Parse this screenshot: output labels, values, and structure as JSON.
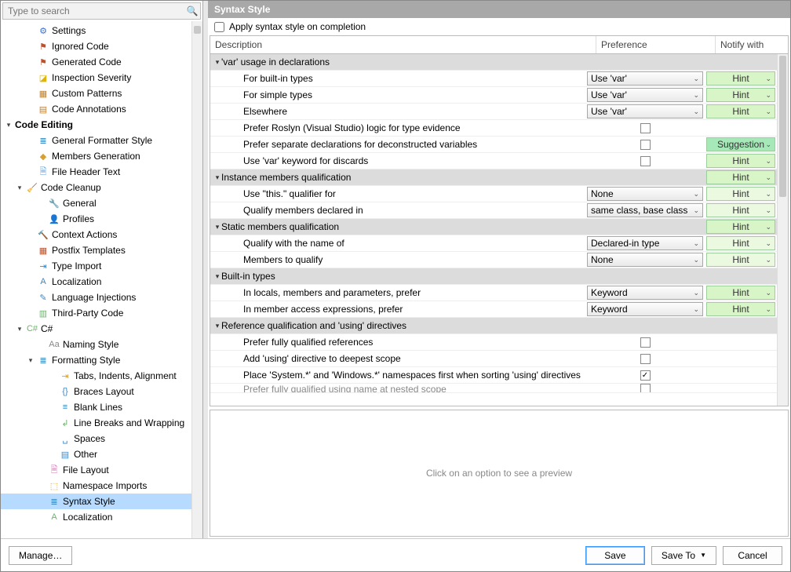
{
  "search": {
    "placeholder": "Type to search"
  },
  "sidebar": {
    "items": [
      {
        "indent": 2,
        "toggle": "",
        "icon": "⚙",
        "iconColor": "#3a6fd8",
        "label": "Settings"
      },
      {
        "indent": 2,
        "toggle": "",
        "icon": "⚑",
        "iconColor": "#c05028",
        "label": "Ignored Code"
      },
      {
        "indent": 2,
        "toggle": "",
        "icon": "⚑",
        "iconColor": "#c05028",
        "label": "Generated Code"
      },
      {
        "indent": 2,
        "toggle": "",
        "icon": "◪",
        "iconColor": "#e0b400",
        "label": "Inspection Severity"
      },
      {
        "indent": 2,
        "toggle": "",
        "icon": "▦",
        "iconColor": "#c08028",
        "label": "Custom Patterns"
      },
      {
        "indent": 2,
        "toggle": "",
        "icon": "▤",
        "iconColor": "#c08028",
        "label": "Code Annotations"
      },
      {
        "indent": 0,
        "toggle": "▾",
        "icon": "",
        "iconColor": "",
        "label": "Code Editing",
        "bold": true
      },
      {
        "indent": 2,
        "toggle": "",
        "icon": "≣",
        "iconColor": "#3a88c8",
        "label": "General Formatter Style"
      },
      {
        "indent": 2,
        "toggle": "",
        "icon": "◆",
        "iconColor": "#d8a030",
        "label": "Members Generation"
      },
      {
        "indent": 2,
        "toggle": "",
        "icon": "🗎",
        "iconColor": "#5899d4",
        "label": "File Header Text"
      },
      {
        "indent": 1,
        "toggle": "▾",
        "icon": "🧹",
        "iconColor": "#6bb46b",
        "label": "Code Cleanup"
      },
      {
        "indent": 3,
        "toggle": "",
        "icon": "🔧",
        "iconColor": "#6bb46b",
        "label": "General"
      },
      {
        "indent": 3,
        "toggle": "",
        "icon": "👤",
        "iconColor": "#d89048",
        "label": "Profiles"
      },
      {
        "indent": 2,
        "toggle": "",
        "icon": "🔨",
        "iconColor": "#9a7040",
        "label": "Context Actions"
      },
      {
        "indent": 2,
        "toggle": "",
        "icon": "▦",
        "iconColor": "#c05028",
        "label": "Postfix Templates"
      },
      {
        "indent": 2,
        "toggle": "",
        "icon": "⇥",
        "iconColor": "#3a88c8",
        "label": "Type Import"
      },
      {
        "indent": 2,
        "toggle": "",
        "icon": "A",
        "iconColor": "#3a88c8",
        "label": "Localization"
      },
      {
        "indent": 2,
        "toggle": "",
        "icon": "✎",
        "iconColor": "#3a88c8",
        "label": "Language Injections"
      },
      {
        "indent": 2,
        "toggle": "",
        "icon": "▥",
        "iconColor": "#6bb46b",
        "label": "Third-Party Code"
      },
      {
        "indent": 1,
        "toggle": "▾",
        "icon": "C#",
        "iconColor": "#6bb46b",
        "label": "C#"
      },
      {
        "indent": 3,
        "toggle": "",
        "icon": "Aa",
        "iconColor": "#888",
        "label": "Naming Style"
      },
      {
        "indent": 2,
        "toggle": "▾",
        "icon": "≣",
        "iconColor": "#3a88c8",
        "label": "Formatting Style"
      },
      {
        "indent": 4,
        "toggle": "",
        "icon": "⇥",
        "iconColor": "#d8a030",
        "label": "Tabs, Indents, Alignment"
      },
      {
        "indent": 4,
        "toggle": "",
        "icon": "{}",
        "iconColor": "#3a88c8",
        "label": "Braces Layout"
      },
      {
        "indent": 4,
        "toggle": "",
        "icon": "≡",
        "iconColor": "#3a88c8",
        "label": "Blank Lines"
      },
      {
        "indent": 4,
        "toggle": "",
        "icon": "↲",
        "iconColor": "#6bb46b",
        "label": "Line Breaks and Wrapping"
      },
      {
        "indent": 4,
        "toggle": "",
        "icon": "␣",
        "iconColor": "#3a88c8",
        "label": "Spaces"
      },
      {
        "indent": 4,
        "toggle": "",
        "icon": "▤",
        "iconColor": "#3a88c8",
        "label": "Other"
      },
      {
        "indent": 3,
        "toggle": "",
        "icon": "🗎",
        "iconColor": "#d070b0",
        "label": "File Layout"
      },
      {
        "indent": 3,
        "toggle": "",
        "icon": "⬚",
        "iconColor": "#d8a030",
        "label": "Namespace Imports"
      },
      {
        "indent": 3,
        "toggle": "",
        "icon": "≣",
        "iconColor": "#3a88c8",
        "label": "Syntax Style",
        "selected": true
      },
      {
        "indent": 3,
        "toggle": "",
        "icon": "A",
        "iconColor": "#6bb46b",
        "label": "Localization"
      }
    ]
  },
  "content": {
    "title": "Syntax Style",
    "apply_label": "Apply syntax style on completion",
    "apply_checked": false,
    "columns": {
      "description": "Description",
      "preference": "Preference",
      "notify": "Notify with"
    },
    "rows": [
      {
        "type": "group",
        "label": "'var' usage in declarations"
      },
      {
        "type": "combo",
        "indent": 2,
        "label": "For built-in types",
        "pref": "Use 'var'",
        "notify": "Hint"
      },
      {
        "type": "combo",
        "indent": 2,
        "label": "For simple types",
        "pref": "Use 'var'",
        "notify": "Hint"
      },
      {
        "type": "combo",
        "indent": 2,
        "label": "Elsewhere",
        "pref": "Use 'var'",
        "notify": "Hint"
      },
      {
        "type": "check",
        "indent": 2,
        "label": "Prefer Roslyn (Visual Studio) logic for type evidence",
        "checked": false
      },
      {
        "type": "check",
        "indent": 2,
        "label": "Prefer separate declarations for deconstructed variables",
        "checked": false,
        "notify": "Suggestion",
        "notifyStyle": "sugg"
      },
      {
        "type": "check",
        "indent": 2,
        "label": "Use 'var' keyword for discards",
        "checked": false,
        "notify": "Hint"
      },
      {
        "type": "group",
        "label": "Instance members qualification",
        "notify": "Hint"
      },
      {
        "type": "combo",
        "indent": 2,
        "label": "Use \"this.\" qualifier for",
        "pref": "None",
        "notify": "Hint",
        "notifyStyle": "dim"
      },
      {
        "type": "combo",
        "indent": 2,
        "label": "Qualify members declared in",
        "pref": "same class, base class",
        "notify": "Hint",
        "notifyStyle": "dim"
      },
      {
        "type": "group",
        "label": "Static members qualification",
        "notify": "Hint"
      },
      {
        "type": "combo",
        "indent": 2,
        "label": "Qualify with the name of",
        "pref": "Declared-in type",
        "notify": "Hint",
        "notifyStyle": "dim"
      },
      {
        "type": "combo",
        "indent": 2,
        "label": "Members to qualify",
        "pref": "None",
        "notify": "Hint",
        "notifyStyle": "dim"
      },
      {
        "type": "group",
        "label": "Built-in types"
      },
      {
        "type": "combo",
        "indent": 2,
        "label": "In locals, members and parameters, prefer",
        "pref": "Keyword",
        "notify": "Hint"
      },
      {
        "type": "combo",
        "indent": 2,
        "label": "In member access expressions, prefer",
        "pref": "Keyword",
        "notify": "Hint"
      },
      {
        "type": "group",
        "label": "Reference qualification and 'using' directives"
      },
      {
        "type": "check",
        "indent": 2,
        "label": "Prefer fully qualified references",
        "checked": false
      },
      {
        "type": "check",
        "indent": 2,
        "label": "Add 'using' directive to deepest scope",
        "checked": false
      },
      {
        "type": "check",
        "indent": 2,
        "label": "Place 'System.*' and 'Windows.*' namespaces first when sorting 'using' directives",
        "checked": true
      },
      {
        "type": "check",
        "indent": 2,
        "label": "Prefer fully qualified using name at nested scope",
        "checked": false,
        "cut": true
      }
    ],
    "preview_text": "Click on an option to see a preview"
  },
  "footer": {
    "manage": "Manage…",
    "save": "Save",
    "save_to": "Save To",
    "cancel": "Cancel"
  }
}
